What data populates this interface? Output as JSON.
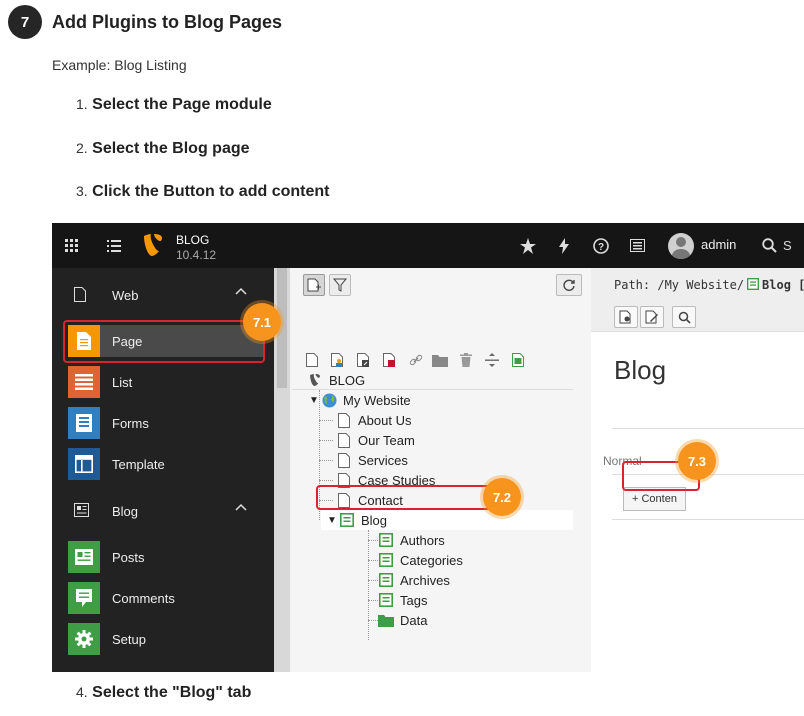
{
  "step": {
    "number": "7",
    "title": "Add Plugins to Blog Pages"
  },
  "example": "Example: Blog Listing",
  "instructions": [
    {
      "num": "1.",
      "text": "Select the Page module"
    },
    {
      "num": "2.",
      "text": "Select the Blog page"
    },
    {
      "num": "3.",
      "text": "Click the Button to add content"
    },
    {
      "num": "4.",
      "text": "Select the \"Blog\" tab"
    }
  ],
  "topbar": {
    "site_name": "BLOG",
    "version": "10.4.12",
    "username": "admin",
    "search_label": "S"
  },
  "module_menu": {
    "groups": [
      {
        "label": "Web",
        "items": [
          "Page",
          "List",
          "Forms",
          "Template"
        ]
      },
      {
        "label": "Blog",
        "items": [
          "Posts",
          "Comments",
          "Setup"
        ]
      }
    ],
    "active_item": "Page"
  },
  "page_tree": {
    "root": "BLOG",
    "site": "My Website",
    "pages": [
      "About Us",
      "Our Team",
      "Services",
      "Case Studies",
      "Contact",
      "Blog"
    ],
    "blog_children": [
      "Authors",
      "Categories",
      "Archives",
      "Tags",
      "Data"
    ],
    "selected": "Blog"
  },
  "content": {
    "path_prefix": "Path: /My Website/",
    "path_current": "Blog [",
    "page_title": "Blog",
    "column_label": "Normal",
    "add_content_label": "+ Conten"
  },
  "callouts": [
    "7.1",
    "7.2",
    "7.3"
  ],
  "colors": {
    "accent_orange": "#f7941d",
    "highlight_red": "#d9232e",
    "topbar_bg": "#151515",
    "module_bg": "#222222"
  }
}
